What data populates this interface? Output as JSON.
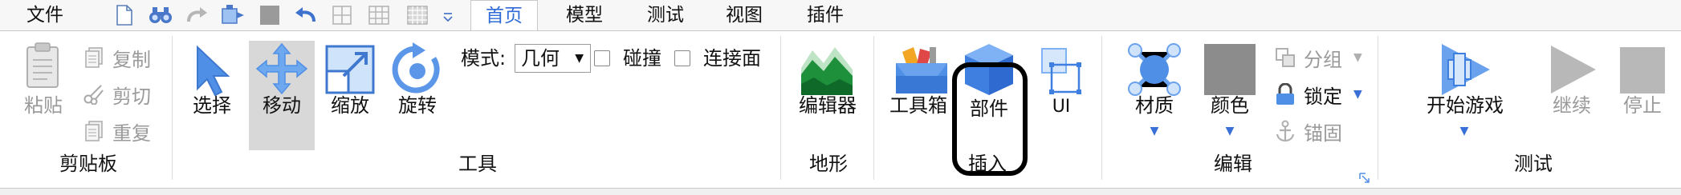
{
  "menu": {
    "file_label": "文件",
    "tabs": [
      {
        "label": "首页",
        "active": true
      },
      {
        "label": "模型",
        "active": false
      },
      {
        "label": "测试",
        "active": false
      },
      {
        "label": "视图",
        "active": false
      },
      {
        "label": "插件",
        "active": false
      }
    ]
  },
  "quick_access": [
    "new-file-icon",
    "binoculars-icon",
    "redo-icon",
    "transform-icon",
    "stop-icon",
    "undo-icon",
    "grid-icon",
    "grid-icon",
    "grid-icon",
    "customize-arrow-icon"
  ],
  "ribbon": {
    "clipboard": {
      "group_label": "剪贴板",
      "paste": "粘贴",
      "copy": "复制",
      "cut": "剪切",
      "duplicate": "重复"
    },
    "tools": {
      "group_label": "工具",
      "select": "选择",
      "move": "移动",
      "scale": "缩放",
      "rotate": "旋转",
      "mode_label": "模式:",
      "mode_value": "几何",
      "collision": "碰撞",
      "join_surfaces": "连接面"
    },
    "terrain": {
      "group_label": "地形",
      "editor": "编辑器"
    },
    "insert": {
      "group_label": "插入",
      "toolbox": "工具箱",
      "part": "部件",
      "ui": "UI"
    },
    "edit": {
      "group_label": "编辑",
      "material": "材质",
      "color": "颜色",
      "group": "分组",
      "lock": "锁定",
      "anchor": "锚固"
    },
    "test": {
      "group_label": "测试",
      "play": "开始游戏",
      "resume": "继续",
      "stop": "停止"
    }
  },
  "colors": {
    "accent_blue": "#2f6bd6",
    "terrain_green": "#1e8f3a",
    "disabled_gray": "#9a9a9a"
  }
}
